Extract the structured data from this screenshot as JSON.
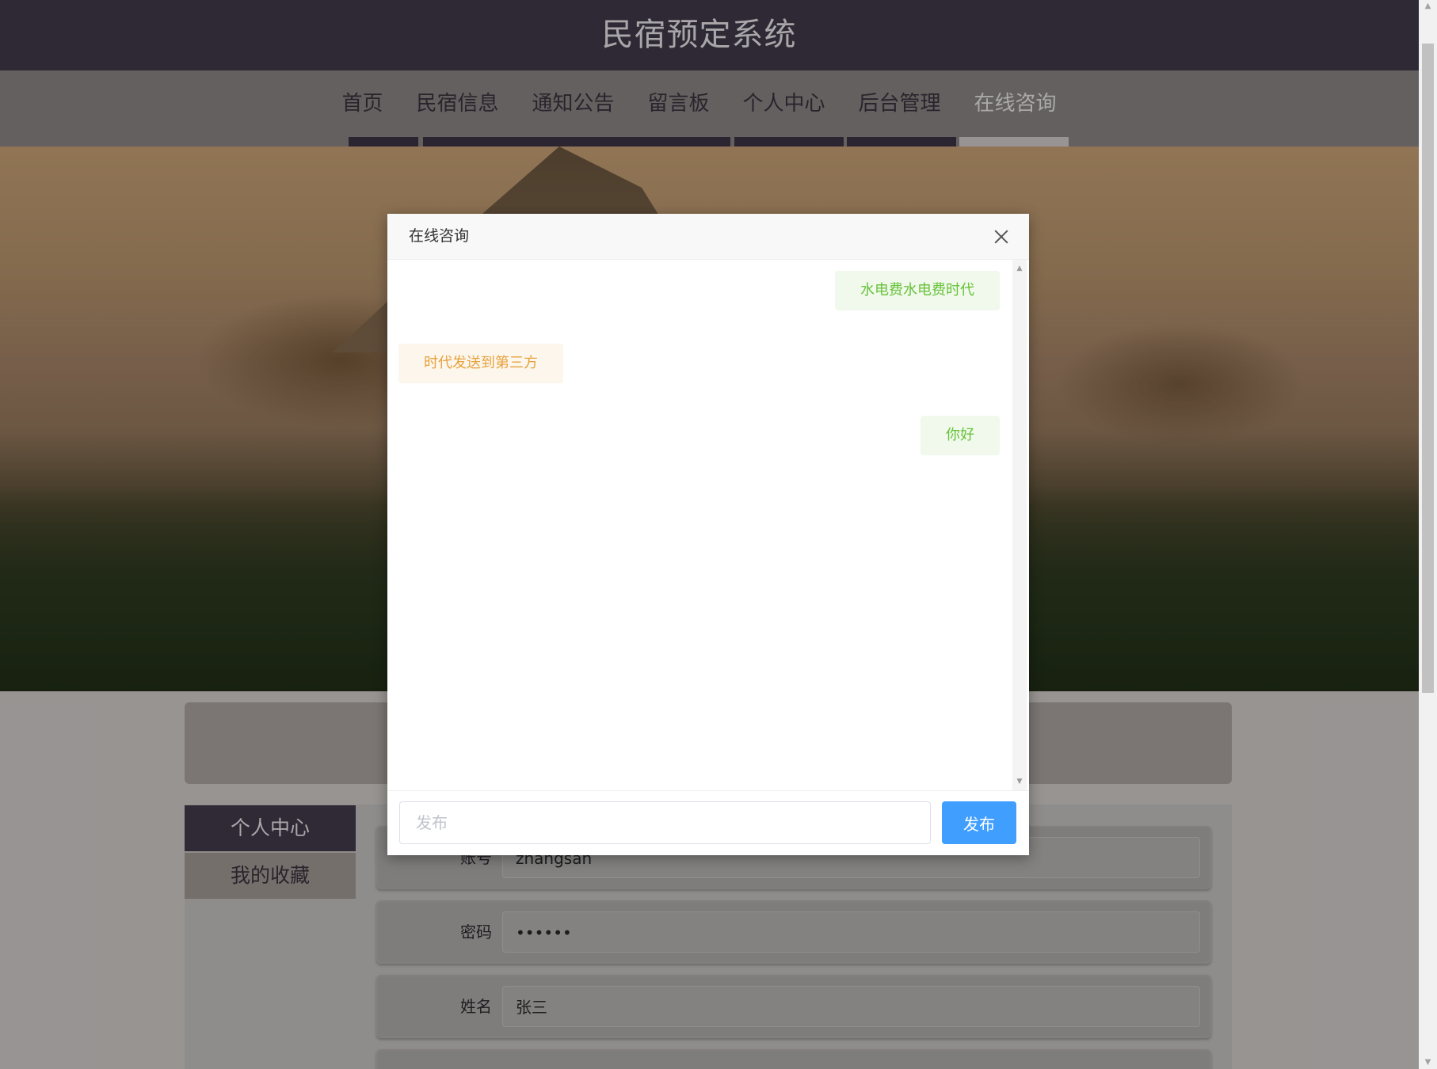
{
  "site": {
    "title": "民宿预定系统"
  },
  "nav": {
    "items": [
      {
        "label": "首页"
      },
      {
        "label": "民宿信息"
      },
      {
        "label": "通知公告"
      },
      {
        "label": "留言板"
      },
      {
        "label": "个人中心"
      },
      {
        "label": "后台管理"
      },
      {
        "label": "在线咨询"
      }
    ],
    "active_label": "在线咨询"
  },
  "side_menu": {
    "items": [
      {
        "label": "个人中心"
      },
      {
        "label": "我的收藏"
      }
    ]
  },
  "form": {
    "fields": [
      {
        "label": "账号",
        "value": "zhangsan"
      },
      {
        "label": "密码",
        "value": "••••••"
      },
      {
        "label": "姓名",
        "value": "张三"
      }
    ]
  },
  "dialog": {
    "title": "在线咨询",
    "messages": [
      {
        "side": "right",
        "text": "水电费水电费时代"
      },
      {
        "side": "left",
        "text": "时代发送到第三方"
      },
      {
        "side": "right",
        "text": "你好"
      }
    ],
    "input_placeholder": "发布",
    "input_value": "",
    "send_label": "发布"
  },
  "colors": {
    "topbar": "#433b4c",
    "send_button": "#409eff",
    "message_right_text": "#67c23a",
    "message_left_text": "#e6a23c"
  }
}
